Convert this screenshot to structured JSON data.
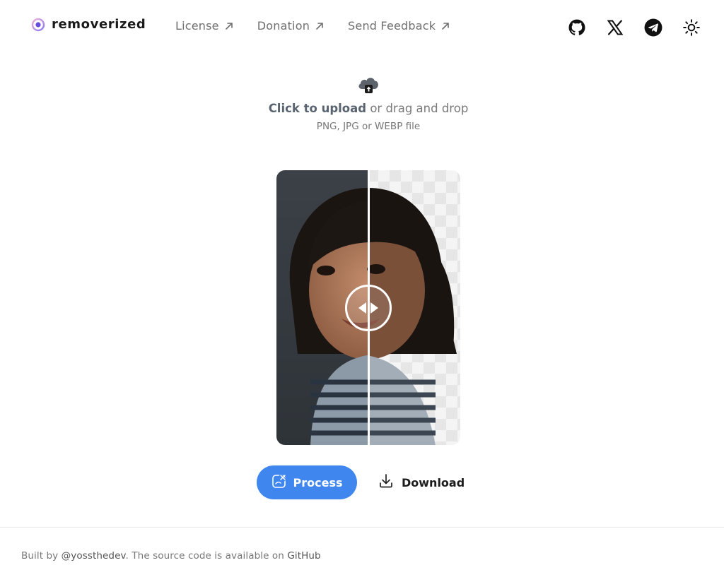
{
  "header": {
    "logo_text": "removerized",
    "nav": [
      {
        "label": "License"
      },
      {
        "label": "Donation"
      },
      {
        "label": "Send Feedback"
      }
    ],
    "icons": [
      "github-icon",
      "x-icon",
      "telegram-icon",
      "sun-icon"
    ]
  },
  "upload": {
    "cta": "Click to upload",
    "rest": "or drag and drop",
    "formats": "PNG, JPG or WEBP file"
  },
  "actions": {
    "process_label": "Process",
    "download_label": "Download"
  },
  "footer": {
    "prefix": "Built by ",
    "author": "@yossthedev",
    "middle": ". The source code is available on ",
    "source_link": "GitHub"
  },
  "colors": {
    "accent": "#3f86ef",
    "text": "#1f1f1f",
    "muted": "#777777"
  }
}
